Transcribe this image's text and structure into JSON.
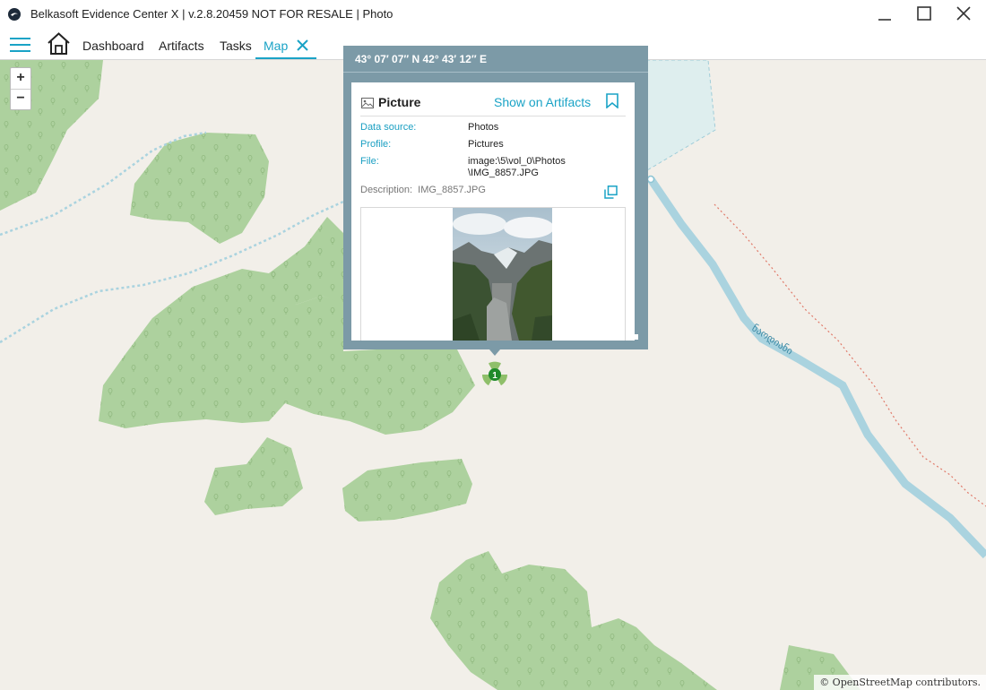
{
  "window": {
    "title": "Belkasoft Evidence Center X | v.2.8.20459 NOT FOR RESALE | Photo"
  },
  "nav": {
    "tabs": [
      {
        "label": "Dashboard"
      },
      {
        "label": "Artifacts"
      },
      {
        "label": "Tasks"
      },
      {
        "label": "Map",
        "active": true
      }
    ]
  },
  "map": {
    "zoom_in": "+",
    "zoom_out": "−",
    "attribution": "© OpenStreetMap contributors.",
    "road_label": "ნაოდიანი",
    "cluster_count": "1",
    "colors": {
      "land": "#f2efe9",
      "forest": "#add19e",
      "water": "#aad3df",
      "accent": "#1aa3c6"
    }
  },
  "popup": {
    "coordinates": "43° 07′ 07″ N 42° 43′ 12″ E",
    "title": "Picture",
    "show_link": "Show on Artifacts",
    "fields": [
      {
        "label": "Data source:",
        "value": "Photos"
      },
      {
        "label": "Profile:",
        "value": "Pictures"
      },
      {
        "label": "File:",
        "value": "image:\\5\\vol_0\\Photos \\IMG_8857.JPG"
      }
    ],
    "description_label": "Description:",
    "description_value": "IMG_8857.JPG"
  }
}
